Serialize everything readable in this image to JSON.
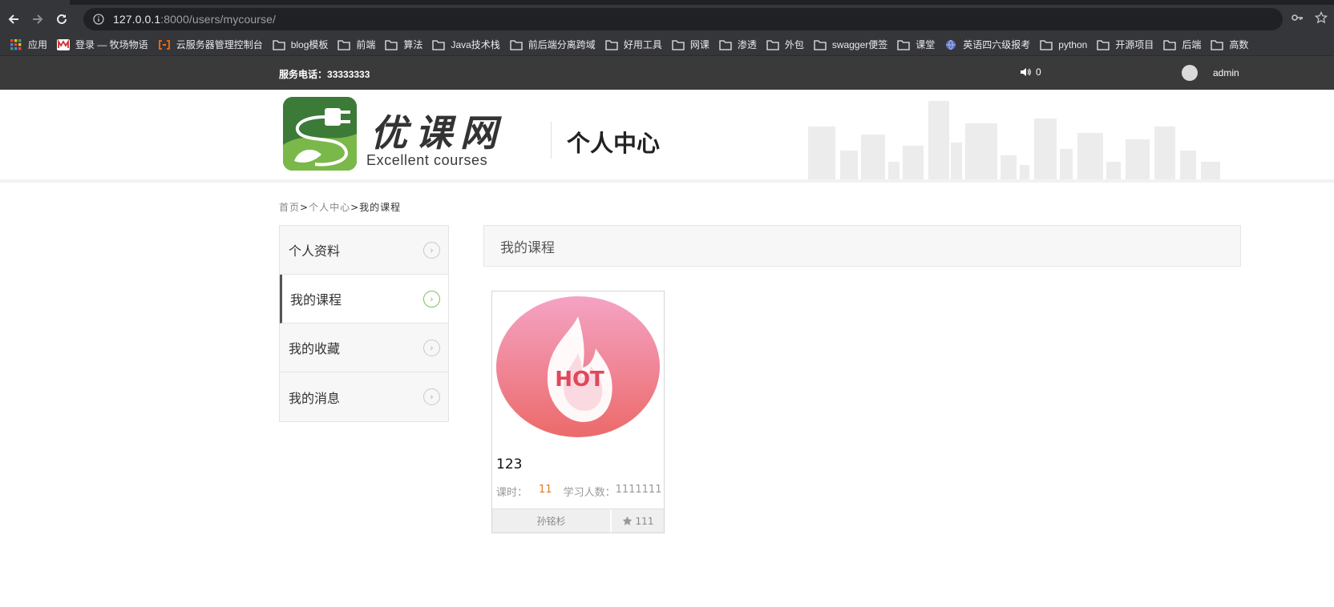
{
  "browser": {
    "url_host": "127.0.0.1",
    "url_rest": ":8000/users/mycourse/",
    "bookmarks": [
      {
        "label": "应用",
        "icon": "apps-grid-icon"
      },
      {
        "label": "登录 — 牧场物语",
        "icon": "site-m-icon"
      },
      {
        "label": "云服务器管理控制台",
        "icon": "aliyun-icon"
      },
      {
        "label": "blog模板",
        "icon": "folder-icon"
      },
      {
        "label": "前端",
        "icon": "folder-icon"
      },
      {
        "label": "算法",
        "icon": "folder-icon"
      },
      {
        "label": "Java技术栈",
        "icon": "folder-icon"
      },
      {
        "label": "前后端分离跨域",
        "icon": "folder-icon"
      },
      {
        "label": "好用工具",
        "icon": "folder-icon"
      },
      {
        "label": "网课",
        "icon": "folder-icon"
      },
      {
        "label": "渗透",
        "icon": "folder-icon"
      },
      {
        "label": "外包",
        "icon": "folder-icon"
      },
      {
        "label": "swagger便签",
        "icon": "folder-icon"
      },
      {
        "label": "课堂",
        "icon": "folder-icon"
      },
      {
        "label": "英语四六级报考",
        "icon": "globe-icon"
      },
      {
        "label": "python",
        "icon": "folder-icon"
      },
      {
        "label": "开源项目",
        "icon": "folder-icon"
      },
      {
        "label": "后端",
        "icon": "folder-icon"
      },
      {
        "label": "高数",
        "icon": "folder-icon"
      }
    ]
  },
  "topbar": {
    "phone_label": "服务电话：",
    "phone_number": "33333333",
    "message_count": "0",
    "username": "admin"
  },
  "header": {
    "logo_cn": "优课网",
    "logo_en": "Excellent courses",
    "title": "个人中心"
  },
  "breadcrumb": {
    "home": "首页",
    "sep": ">",
    "center": "个人中心",
    "current": "我的课程"
  },
  "sidebar": {
    "items": [
      {
        "label": "个人资料",
        "active": false
      },
      {
        "label": "我的课程",
        "active": true
      },
      {
        "label": "我的收藏",
        "active": false
      },
      {
        "label": "我的消息",
        "active": false
      }
    ]
  },
  "main": {
    "title": "我的课程",
    "courses": [
      {
        "name": "123",
        "hours_label": "课时：",
        "hours": "11",
        "students_label": "学习人数：",
        "students": "1111111",
        "teacher": "孙铭杉",
        "favorites": "111",
        "image_text": "HOT"
      }
    ]
  },
  "colors": {
    "topbar_bg": "#3a3a3a",
    "accent_green": "#7bbf56",
    "hours_orange": "#e07b20",
    "logo_green": "#3b7a37"
  }
}
